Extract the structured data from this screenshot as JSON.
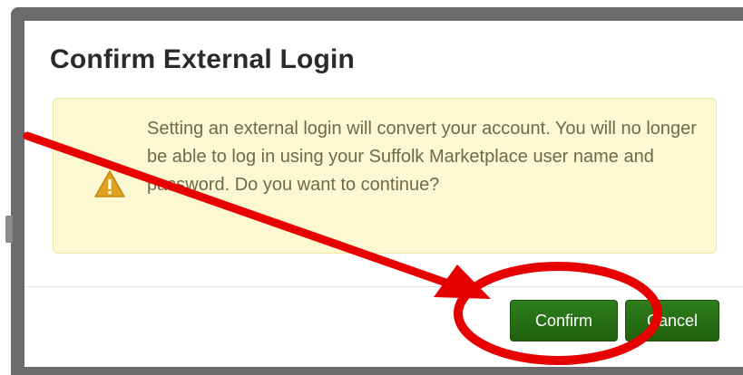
{
  "dialog": {
    "title": "Confirm External Login",
    "alert_text": "Setting an external login will convert your account. You will no longer be able to log in using your Suffolk Marketplace user name and password. Do you want to continue?",
    "alert_icon": "warning-icon",
    "confirm_label": "Confirm",
    "cancel_label": "Cancel"
  },
  "colors": {
    "button": "#2b7317",
    "alert_background": "#fcf8d2",
    "annotation": "#e60000",
    "backdrop": "#6b6b6b"
  }
}
